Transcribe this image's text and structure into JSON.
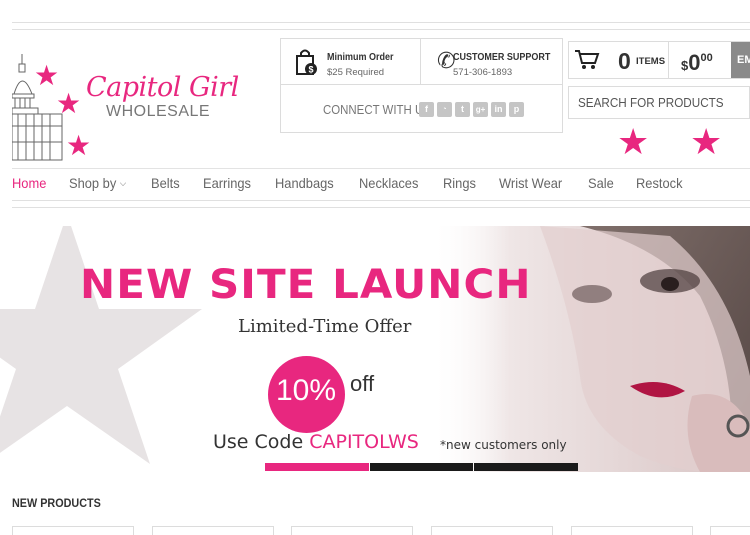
{
  "logo": {
    "script": "Capitol Girl",
    "sub": "WHOLESALE"
  },
  "info": {
    "min_order_title": "Minimum Order",
    "min_order_sub": "$25 Required",
    "support_title": "CUSTOMER SUPPORT",
    "support_phone": "571-306-1893",
    "connect_label": "CONNECT WITH US",
    "socials": [
      "f",
      "rss",
      "t",
      "g+",
      "in",
      "p"
    ]
  },
  "cart": {
    "count": "0",
    "items_label": "ITEMS",
    "currency": "$",
    "amount": "0",
    "cents": "00",
    "button": "EM"
  },
  "search": {
    "placeholder": "SEARCH FOR PRODUCTS"
  },
  "nav": [
    {
      "label": "Home",
      "active": true
    },
    {
      "label": "Shop by",
      "dropdown": true
    },
    {
      "label": "Belts"
    },
    {
      "label": "Earrings"
    },
    {
      "label": "Handbags"
    },
    {
      "label": "Necklaces"
    },
    {
      "label": "Rings"
    },
    {
      "label": "Wrist Wear"
    },
    {
      "label": "Sale"
    },
    {
      "label": "Restock"
    }
  ],
  "banner": {
    "title": "NEW SITE LAUNCH",
    "offer": "Limited-Time Offer",
    "percent": "10%",
    "off": "off",
    "code_prefix": "Use Code ",
    "code": "CAPITOLWS",
    "note": "*new customers only",
    "slides": 3,
    "active_slide": 1
  },
  "sections": {
    "new_products": "NEW PRODUCTS"
  },
  "colors": {
    "accent": "#e8277f",
    "slide_inactive": "#1a1a1a"
  },
  "icons": [
    "capitol-building-icon",
    "star-icon",
    "shopping-bag-icon",
    "phone-icon",
    "cart-icon",
    "chevron-down-icon"
  ]
}
